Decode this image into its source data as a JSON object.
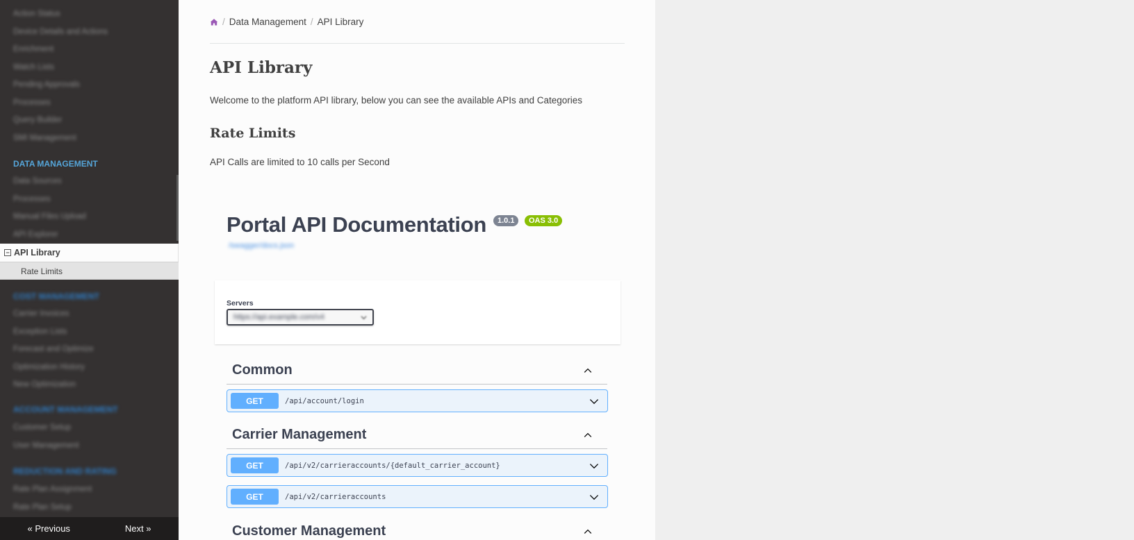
{
  "sidebar": {
    "top_items": [
      "Action Status",
      "Device Details and Actions",
      "Enrichment",
      "Watch Lists",
      "Pending Approvals",
      "Processes",
      "Query Builder",
      "SMI Management"
    ],
    "data_management_caption": "DATA MANAGEMENT",
    "data_management_items": [
      "Data Sources",
      "Processes",
      "Manual Files Upload",
      "API Explorer"
    ],
    "current": "API Library",
    "current_toggle": "−",
    "current_sub": "Rate Limits",
    "cost_caption": "COST MANAGEMENT",
    "cost_items": [
      "Carrier Invoices",
      "Exception Lists",
      "Forecast and Optimize",
      "Optimization History",
      "New Optimization"
    ],
    "account_caption": "ACCOUNT MANAGEMENT",
    "account_items": [
      "Customer Setup",
      "User Management"
    ],
    "rate_caption": "REDUCTION AND RATING",
    "rate_items": [
      "Rate Plan Assignment",
      "Rate Plan Setup"
    ],
    "pager": {
      "previous": "« Previous",
      "next": "Next »"
    }
  },
  "breadcrumb": {
    "section": "Data Management",
    "page": "API Library"
  },
  "page": {
    "title": "API Library",
    "intro": "Welcome to the platform API library, below you can see the available APIs and Categories",
    "rate_heading": "Rate Limits",
    "rate_text": "API Calls are limited to 10 calls per Second"
  },
  "swagger": {
    "title": "Portal API Documentation",
    "version": "1.0.1",
    "oas": "OAS 3.0",
    "url": "/swagger/docs.json",
    "servers_label": "Servers",
    "server_selected": "https://api.example.com/v4",
    "tags": [
      {
        "name": "Common",
        "ops": [
          {
            "method": "GET",
            "path": "/api/account/login"
          }
        ]
      },
      {
        "name": "Carrier Management",
        "ops": [
          {
            "method": "GET",
            "path": "/api/v2/carrieraccounts/{default_carrier_account}"
          },
          {
            "method": "GET",
            "path": "/api/v2/carrieraccounts"
          }
        ]
      },
      {
        "name": "Customer Management",
        "ops": []
      }
    ]
  },
  "colors": {
    "sidebar_bg": "#343131",
    "get_blue": "#61affe",
    "home_icon": "#9b59b6",
    "version_badge": "#7d8492",
    "oas_badge": "#89bf04"
  }
}
